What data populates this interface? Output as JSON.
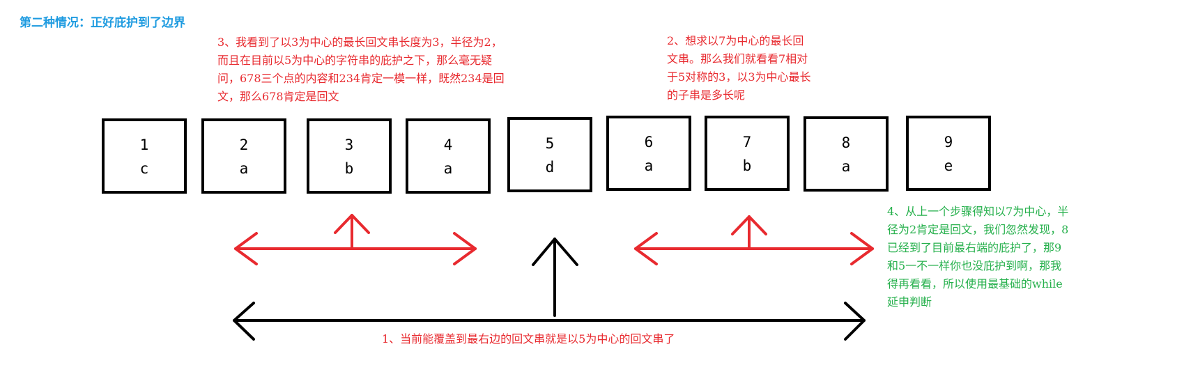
{
  "title": "第二种情况：正好庇护到了边界",
  "notes": {
    "note1": "1、当前能覆盖到最右边的回文串就是以5为中心的回文串了",
    "note2": "2、想求以7为中心的最长回\n文串。那么我们就看看7相对\n于5对称的3，以3为中心最长\n的子串是多长呢",
    "note3": "3、我看到了以3为中心的最长回文串长度为3，半径为2，\n而且在目前以5为中心的字符串的庇护之下，那么毫无疑\n问，678三个点的内容和234肯定一模一样，既然234是回\n文，那么678肯定是回文",
    "note4": "4、从上一个步骤得知以7为中心，半\n径为2肯定是回文，我们忽然发现，8\n已经到了目前最右端的庇护了，那9\n和5一不一样你也没庇护到啊，那我\n得再看看，所以使用最基础的while\n延申判断"
  },
  "cells": [
    {
      "index": "1",
      "char": "c"
    },
    {
      "index": "2",
      "char": "a"
    },
    {
      "index": "3",
      "char": "b"
    },
    {
      "index": "4",
      "char": "a"
    },
    {
      "index": "5",
      "char": "d"
    },
    {
      "index": "6",
      "char": "a"
    },
    {
      "index": "7",
      "char": "b"
    },
    {
      "index": "8",
      "char": "a"
    },
    {
      "index": "9",
      "char": "e"
    }
  ],
  "colors": {
    "title": "#1e9be0",
    "red": "#e82a2f",
    "green": "#26b04c",
    "black": "#000000"
  }
}
